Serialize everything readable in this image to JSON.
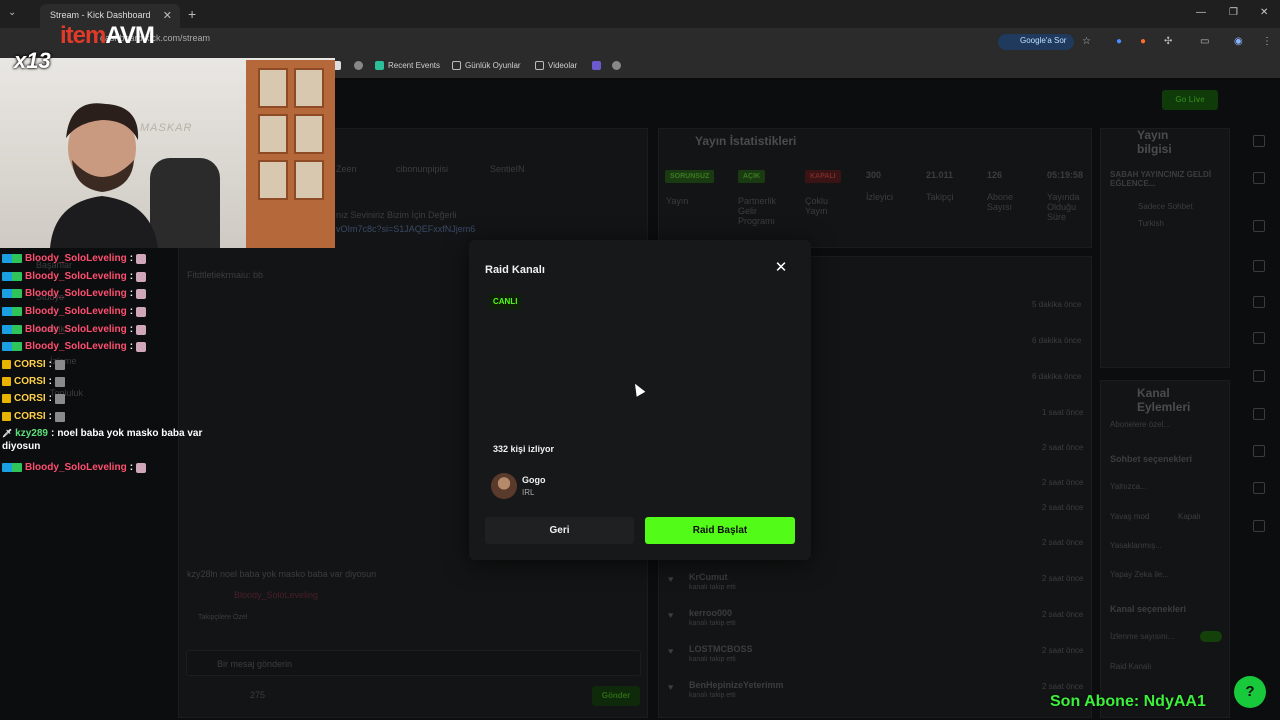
{
  "browser": {
    "tab_title": "Stream - Kick Dashboard",
    "url": "dashboard.kick.com/stream",
    "google_label": "Google'a Sor",
    "bookmarks": [
      "Recent Events",
      "Günlük Oyunlar",
      "Videolar"
    ]
  },
  "overlay": {
    "brand_left": "i",
    "brand_right": "tem",
    "brand_suffix": "AVM",
    "multiplier": "x13",
    "wall_text": "MASKAR",
    "last_sub": "Son Abone: NdyAA1"
  },
  "stream_chat": [
    {
      "user": "Bloody_SoloLeveling",
      "kind": "pink",
      "text": ""
    },
    {
      "user": "Bloody_SoloLeveling",
      "kind": "pink",
      "text": ""
    },
    {
      "user": "Bloody_SoloLeveling",
      "kind": "pink",
      "text": ""
    },
    {
      "user": "Bloody_SoloLeveling",
      "kind": "pink",
      "text": ""
    },
    {
      "user": "Bloody_SoloLeveling",
      "kind": "pink",
      "text": ""
    },
    {
      "user": "Bloody_SoloLeveling",
      "kind": "pink",
      "text": ""
    },
    {
      "user": "CORSI",
      "kind": "yel",
      "text": ""
    },
    {
      "user": "CORSI",
      "kind": "yel",
      "text": ""
    },
    {
      "user": "CORSI",
      "kind": "yel",
      "text": ""
    },
    {
      "user": "CORSI",
      "kind": "yel",
      "text": ""
    },
    {
      "user": "kzy289",
      "kind": "grn",
      "text": "noel baba yok masko baba var"
    },
    {
      "user": "Bloody_SoloLeveling",
      "kind": "pink",
      "text": ""
    }
  ],
  "stream_chat_wrap": "diyosun",
  "dashboard": {
    "stats_title": "Yayın İstatistikleri",
    "stat_badges": [
      "SORUNSUZ",
      "AÇIK",
      "KAPALI"
    ],
    "stat_labels": [
      "Yayın",
      "Partnerlik Gelir Programı",
      "Çoklu Yayın"
    ],
    "stat_values": [
      "300",
      "21.011",
      "126",
      "05:19:58"
    ],
    "stat_names": [
      "İzleyici",
      "Takipçi",
      "Abone Sayısı",
      "Yayında Olduğu Süre"
    ],
    "info_title": "Yayın bilgisi",
    "info_stream_title": "SABAH YAYINCINIZ GELDİ EĞLENCE...",
    "info_category": "Sadece Sohbet",
    "info_lang": "Turkish",
    "actions_title": "Kanal Eylemleri",
    "actions": [
      "Abonelere özel...",
      "Sohbet seçenekleri",
      "Yalnızca...",
      "Yavaş mod",
      "Yasaklanmış...",
      "Yapay Zeka ile...",
      "Kanal seçenekleri",
      "İzlenme sayısını...",
      "Raid Kanalı"
    ],
    "slow_mode_value": "Kapalı",
    "events": [
      {
        "name": "KrCumut",
        "action": "kanalı takip etti",
        "time": "2 saat önce"
      },
      {
        "name": "kerroo000",
        "action": "kanalı takip etti",
        "time": "2 saat önce"
      },
      {
        "name": "LOSTMCBOSS",
        "action": "kanalı takip etti",
        "time": "2 saat önce"
      },
      {
        "name": "BenHepinizeYeterimm",
        "action": "kanalı takip etti",
        "time": "2 saat önce"
      }
    ],
    "event_times_top": [
      "5 dakika önce",
      "6 dakika önce",
      "6 dakika önce",
      "1 saat önce",
      "2 saat önce",
      "2 saat önce",
      "2 saat önce",
      "2 saat önce"
    ],
    "chat_input_placeholder": "Bir mesaj gönderin",
    "send_label": "Gönder",
    "viewer_count": "275",
    "go_live": "Go Live",
    "sidebar_items": [
      "Başarılar",
      "Stüdyo",
      "Analitik",
      "İzleme",
      "Topluluk"
    ],
    "pinned_text": "nız Seviniriz Bizim İçin Değerli",
    "pinned_link": "vOIm7c8c?si=S1JAQEFxxfNJjem6",
    "chat_users_top": [
      "Zeen",
      "cibonunpipisi",
      "SentieIN"
    ],
    "chat_dim_line": "kzy28ln  noel baba yok masko baba var diyosun",
    "chat_dim_name": "Bloody_SoloLeveling",
    "chat_first": "Fitdtletiekrmaiu: bb",
    "emote_label": "Takipçilere Özel"
  },
  "modal": {
    "title": "Raid Kanalı",
    "live_badge": "CANLI",
    "viewers": "332 kişi izliyor",
    "channel_name": "Gogo",
    "channel_category": "IRL",
    "back_label": "Geri",
    "raid_label": "Raid Başlat"
  }
}
